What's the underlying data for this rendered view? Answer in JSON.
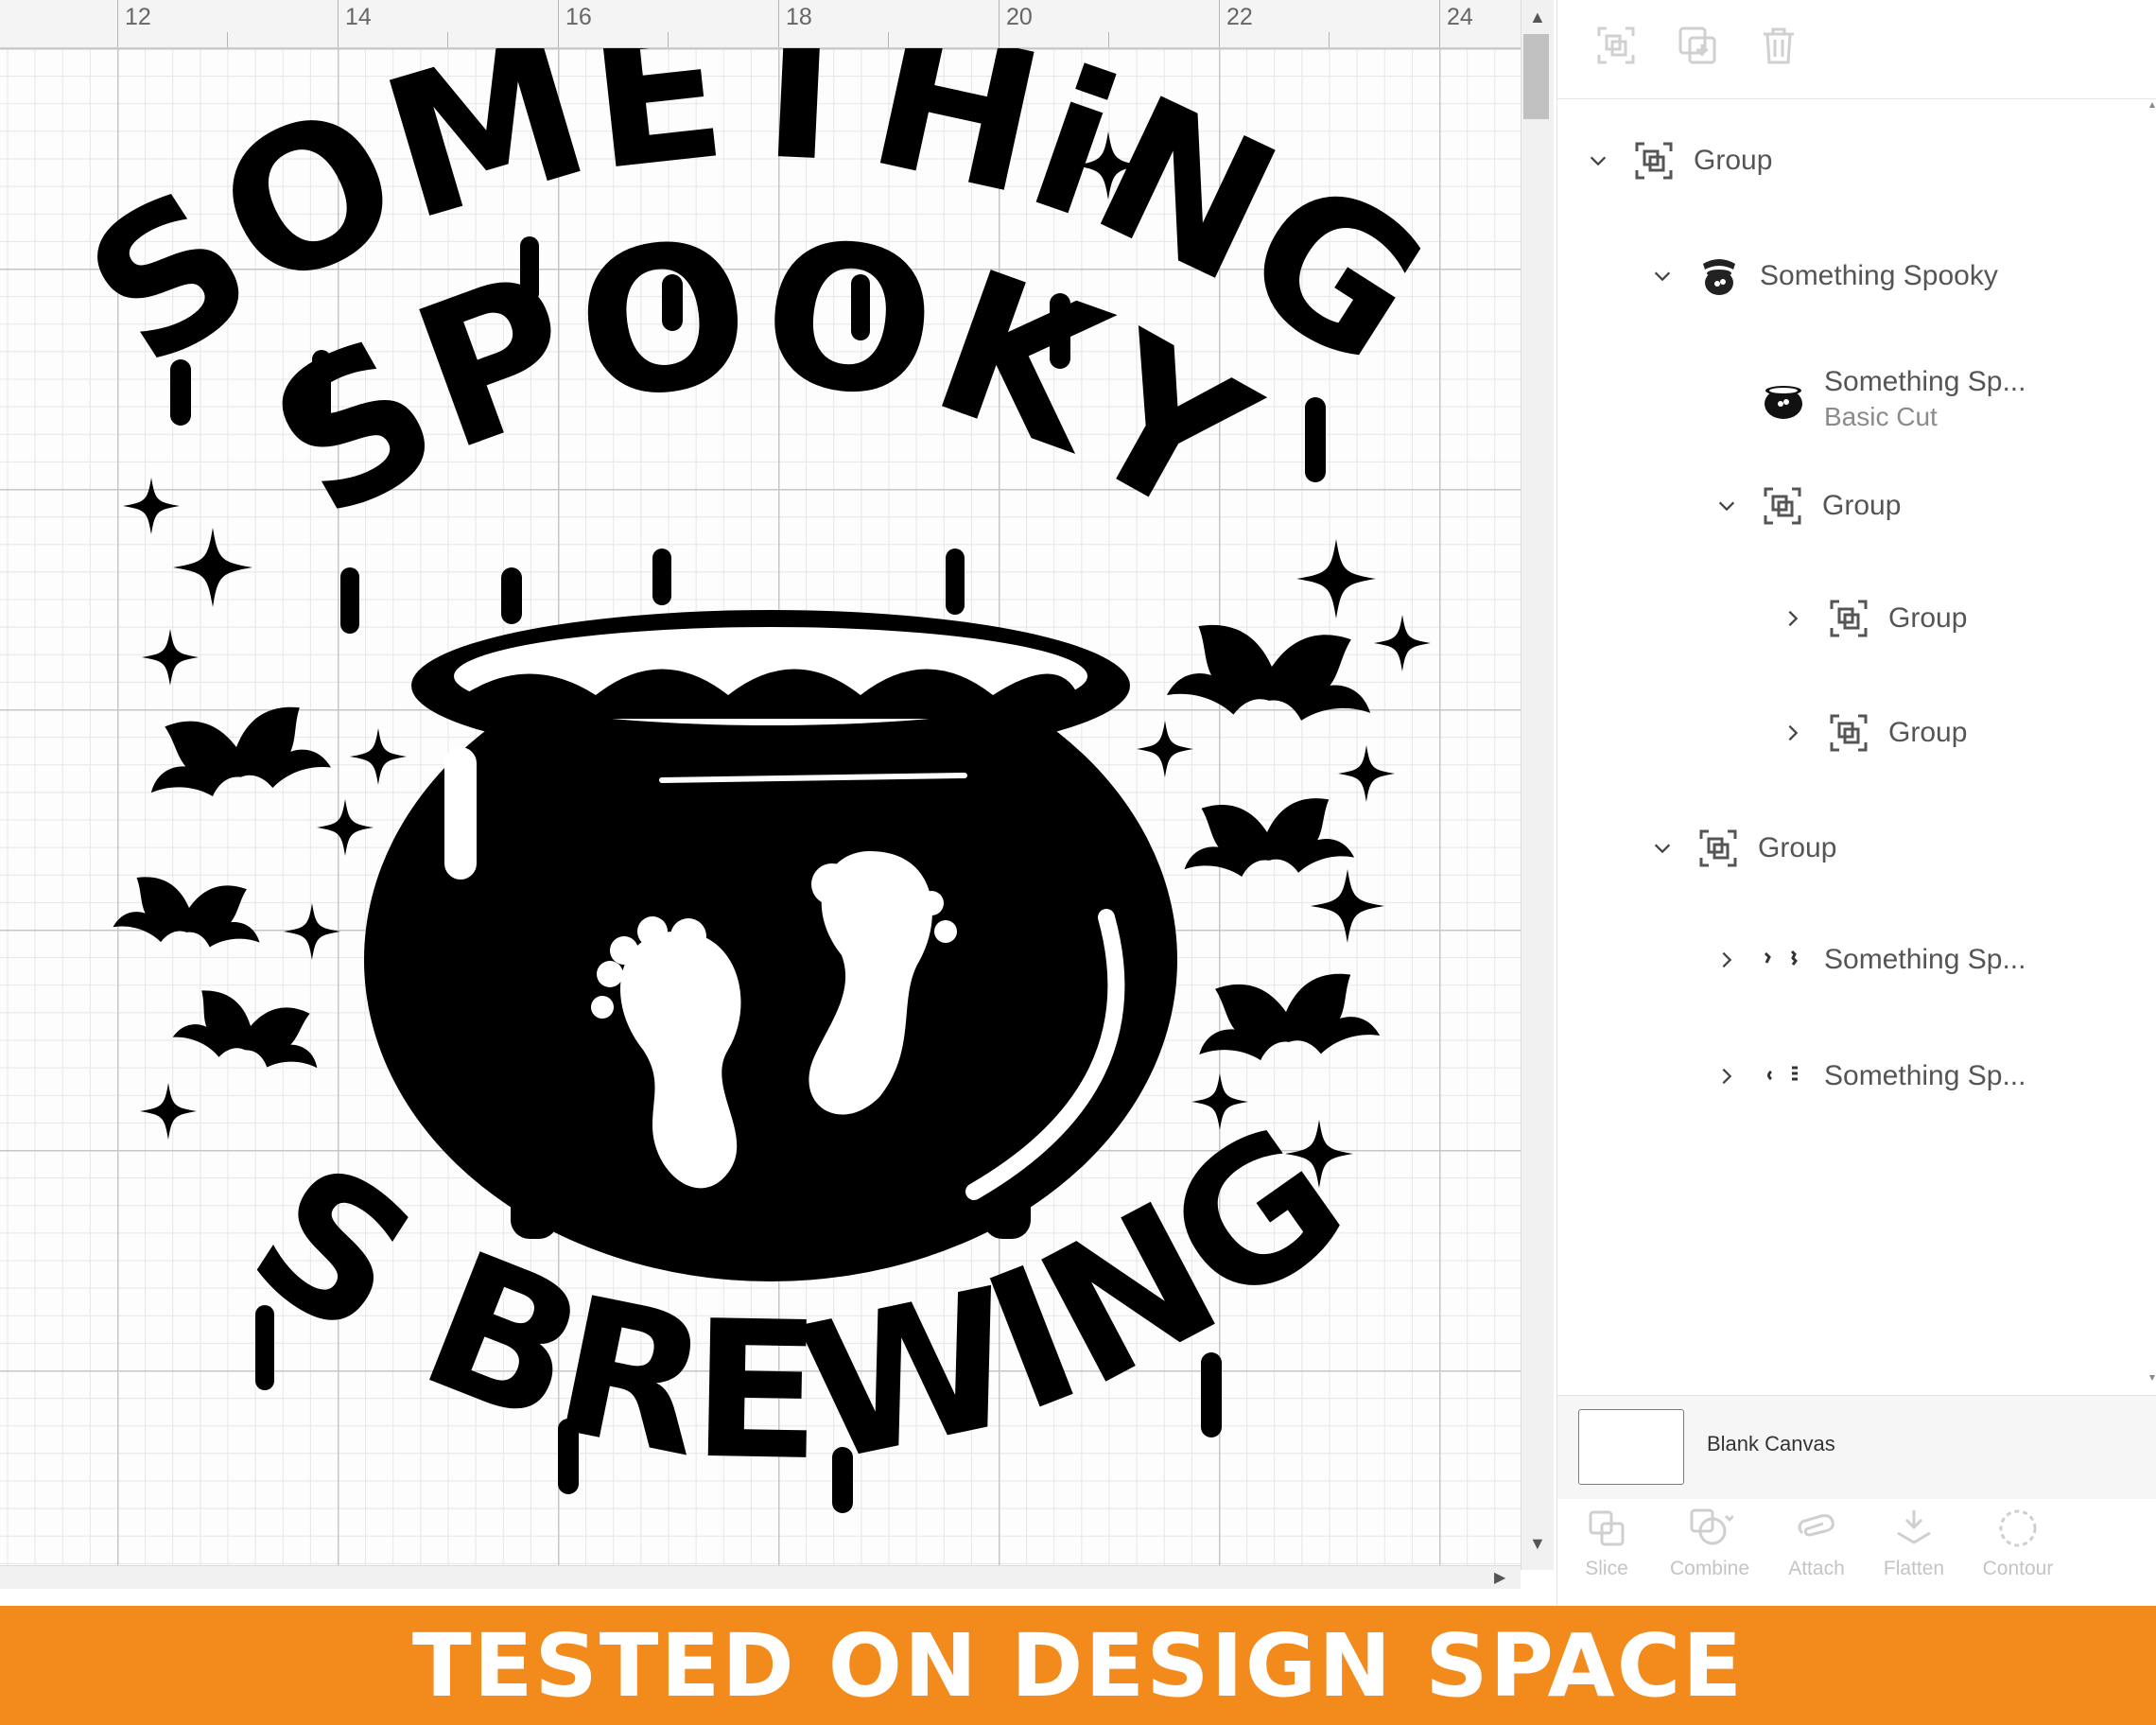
{
  "ruler": {
    "labels": [
      "12",
      "14",
      "16",
      "18",
      "20",
      "22",
      "24"
    ]
  },
  "artwork": {
    "line1": "SOMETHiNG",
    "line2": "SPOOKY",
    "line3": "IS BREWING",
    "color": "#000000"
  },
  "layers": {
    "items": [
      {
        "label": "Group",
        "sub": "",
        "icon": "group-icon",
        "expanded": "down"
      },
      {
        "label": "Something Spooky",
        "sub": "",
        "icon": "image-thumbnail",
        "expanded": "down"
      },
      {
        "label": "Something Sp...",
        "sub": "Basic Cut",
        "icon": "cauldron-thumbnail",
        "expanded": ""
      },
      {
        "label": "Group",
        "sub": "",
        "icon": "group-icon",
        "expanded": "down"
      },
      {
        "label": "Group",
        "sub": "",
        "icon": "group-icon",
        "expanded": "right"
      },
      {
        "label": "Group",
        "sub": "",
        "icon": "group-icon",
        "expanded": "right"
      },
      {
        "label": "Group",
        "sub": "",
        "icon": "group-icon",
        "expanded": "down"
      },
      {
        "label": "Something Sp...",
        "sub": "",
        "icon": "fragment-thumbnail",
        "expanded": "right"
      },
      {
        "label": "Something Sp...",
        "sub": "",
        "icon": "fragment-thumbnail",
        "expanded": "right"
      }
    ],
    "blank_canvas_label": "Blank Canvas"
  },
  "bottom_tools": {
    "slice": "Slice",
    "combine": "Combine",
    "attach": "Attach",
    "flatten": "Flatten",
    "contour": "Contour"
  },
  "banner": {
    "text": "TESTED ON DESIGN SPACE",
    "color": "#f28a1c"
  }
}
